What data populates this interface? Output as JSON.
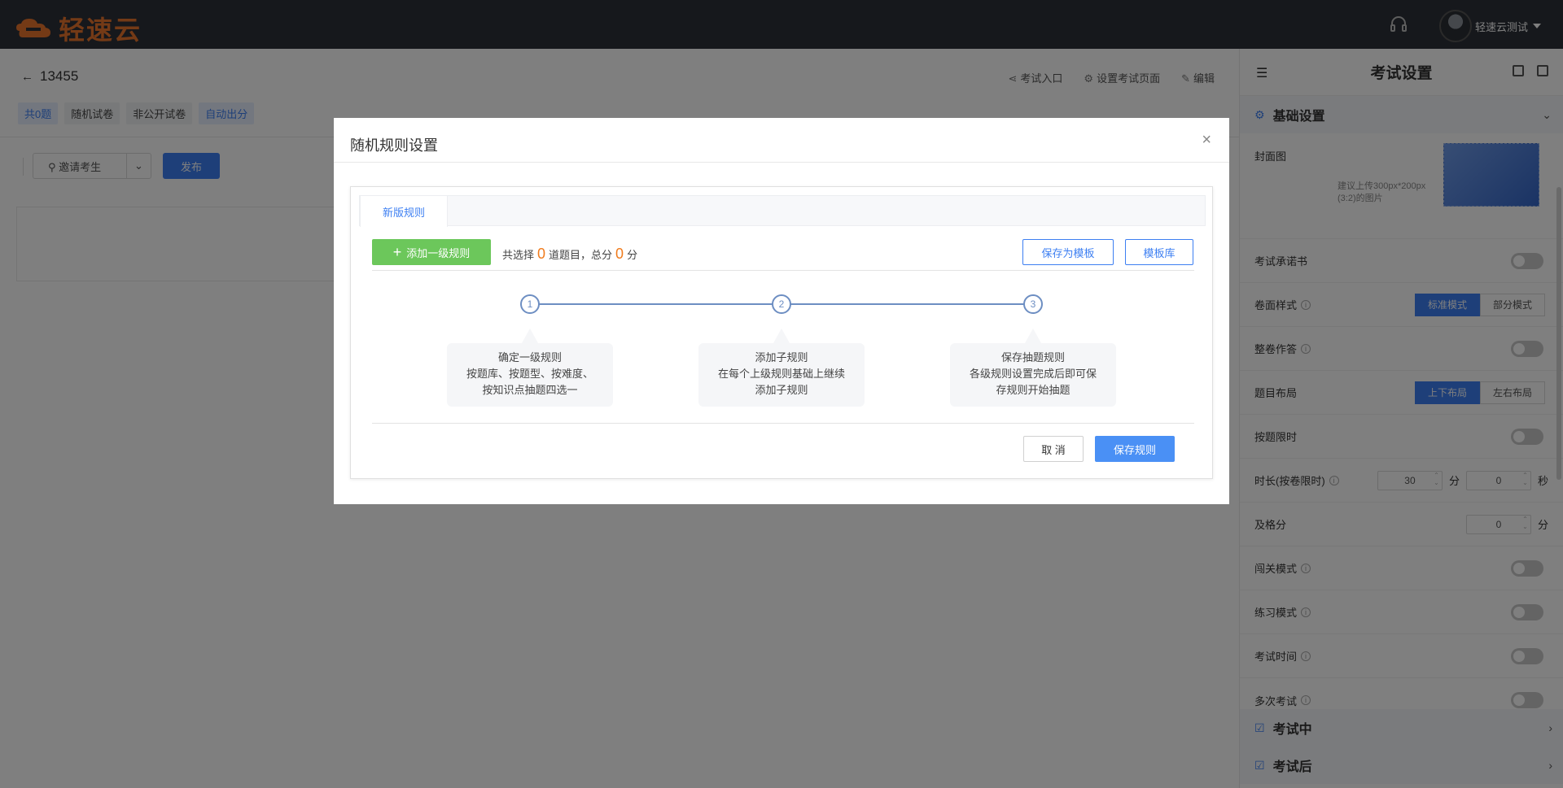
{
  "topbar": {
    "logo_text": "轻速云",
    "user_name": "轻速云测试"
  },
  "page": {
    "title": "13455",
    "actions": [
      "考试入口",
      "设置考试页面",
      "编辑"
    ],
    "tags": [
      "共0题",
      "随机试卷",
      "非公开试卷",
      "自动出分"
    ],
    "invite_label": "邀请考生",
    "publish_label": "发布"
  },
  "right_panel": {
    "title": "考试设置",
    "basic_section": "基础设置",
    "cover_label": "封面图",
    "cover_hint": "建议上传300px*200px (3:2)的图片",
    "rows": {
      "promise": "考试承诺书",
      "paper_style": "卷面样式",
      "paper_style_opts": [
        "标准模式",
        "部分模式"
      ],
      "whole_answer": "整卷作答",
      "layout": "题目布局",
      "layout_opts": [
        "上下布局",
        "左右布局"
      ],
      "per_question_time": "按题限时",
      "duration": "时长(按卷限时)",
      "duration_min": "30",
      "min_unit": "分",
      "duration_sec": "0",
      "sec_unit": "秒",
      "pass_score": "及格分",
      "pass_value": "0",
      "pass_unit": "分",
      "level_mode": "闯关模式",
      "practice_mode": "练习模式",
      "exam_time": "考试时间",
      "multi_exam": "多次考试"
    },
    "during_section": "考试中",
    "after_section": "考试后"
  },
  "modal": {
    "title": "随机规则设置",
    "tab": "新版规则",
    "add_rule": "添加一级规则",
    "count_prefix": "共选择",
    "count_value": "0",
    "count_mid": "道题目，总分",
    "score_value": "0",
    "score_unit": "分",
    "save_template": "保存为模板",
    "template_lib": "模板库",
    "steps": [
      {
        "num": "1",
        "lines": [
          "确定一级规则",
          "按题库、按题型、按难度、",
          "按知识点抽题四选一"
        ]
      },
      {
        "num": "2",
        "lines": [
          "添加子规则",
          "在每个上级规则基础上继续",
          "添加子规则"
        ]
      },
      {
        "num": "3",
        "lines": [
          "保存抽题规则",
          "各级规则设置完成后即可保",
          "存规则开始抽题"
        ]
      }
    ],
    "cancel": "取 消",
    "save": "保存规则"
  },
  "colors": {
    "accent": "#3d7ff2",
    "topbar": "#2d3138",
    "add_green": "#6cc75b",
    "count_orange": "#f07b1c",
    "logo_orange": "#e8742c"
  }
}
